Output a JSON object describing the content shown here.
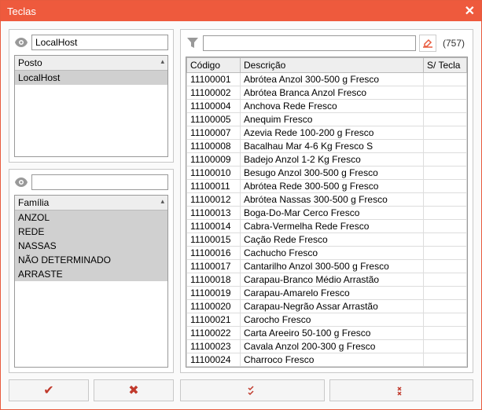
{
  "window": {
    "title": "Teclas"
  },
  "left": {
    "posto": {
      "filter_value": "LocalHost",
      "header": "Posto",
      "items": [
        {
          "label": "LocalHost",
          "selected": true
        }
      ]
    },
    "familia": {
      "filter_value": "",
      "header": "Família",
      "items": [
        {
          "label": "ANZOL",
          "selected": true
        },
        {
          "label": "REDE",
          "selected": true
        },
        {
          "label": "NASSAS",
          "selected": true
        },
        {
          "label": "NÃO DETERMINADO",
          "selected": true
        },
        {
          "label": "ARRASTE",
          "selected": true
        }
      ]
    }
  },
  "right": {
    "filter_value": "",
    "count_label": "(757)",
    "columns": {
      "codigo": "Código",
      "descricao": "Descrição",
      "stecla": "S/ Tecla"
    },
    "rows": [
      {
        "codigo": "11100001",
        "descricao": "Abrótea Anzol 300-500 g Fresco",
        "stecla": ""
      },
      {
        "codigo": "11100002",
        "descricao": "Abrótea Branca Anzol Fresco",
        "stecla": ""
      },
      {
        "codigo": "11100004",
        "descricao": "Anchova Rede Fresco",
        "stecla": ""
      },
      {
        "codigo": "11100005",
        "descricao": "Anequim Fresco",
        "stecla": ""
      },
      {
        "codigo": "11100007",
        "descricao": "Azevia Rede 100-200 g Fresco",
        "stecla": ""
      },
      {
        "codigo": "11100008",
        "descricao": "Bacalhau Mar 4-6 Kg Fresco S",
        "stecla": ""
      },
      {
        "codigo": "11100009",
        "descricao": "Badejo Anzol 1-2 Kg Fresco",
        "stecla": ""
      },
      {
        "codigo": "11100010",
        "descricao": "Besugo Anzol 300-500 g Fresco",
        "stecla": ""
      },
      {
        "codigo": "11100011",
        "descricao": "Abrótea Rede 300-500 g Fresco",
        "stecla": ""
      },
      {
        "codigo": "11100012",
        "descricao": "Abrótea Nassas 300-500 g Fresco",
        "stecla": ""
      },
      {
        "codigo": "11100013",
        "descricao": "Boga-Do-Mar Cerco Fresco",
        "stecla": ""
      },
      {
        "codigo": "11100014",
        "descricao": "Cabra-Vermelha Rede Fresco",
        "stecla": ""
      },
      {
        "codigo": "11100015",
        "descricao": "Cação Rede Fresco",
        "stecla": ""
      },
      {
        "codigo": "11100016",
        "descricao": "Cachucho Fresco",
        "stecla": ""
      },
      {
        "codigo": "11100017",
        "descricao": "Cantarilho Anzol 300-500 g Fresco",
        "stecla": ""
      },
      {
        "codigo": "11100018",
        "descricao": "Carapau-Branco Médio Arrastão",
        "stecla": ""
      },
      {
        "codigo": "11100019",
        "descricao": "Carapau-Amarelo Fresco",
        "stecla": ""
      },
      {
        "codigo": "11100020",
        "descricao": "Carapau-Negrão Assar Arrastão",
        "stecla": ""
      },
      {
        "codigo": "11100021",
        "descricao": "Carocho Fresco",
        "stecla": ""
      },
      {
        "codigo": "11100022",
        "descricao": "Carta Areeiro 50-100 g Fresco",
        "stecla": ""
      },
      {
        "codigo": "11100023",
        "descricao": "Cavala Anzol 200-300 g Fresco",
        "stecla": ""
      },
      {
        "codigo": "11100024",
        "descricao": "Charroco Fresco",
        "stecla": ""
      }
    ]
  }
}
